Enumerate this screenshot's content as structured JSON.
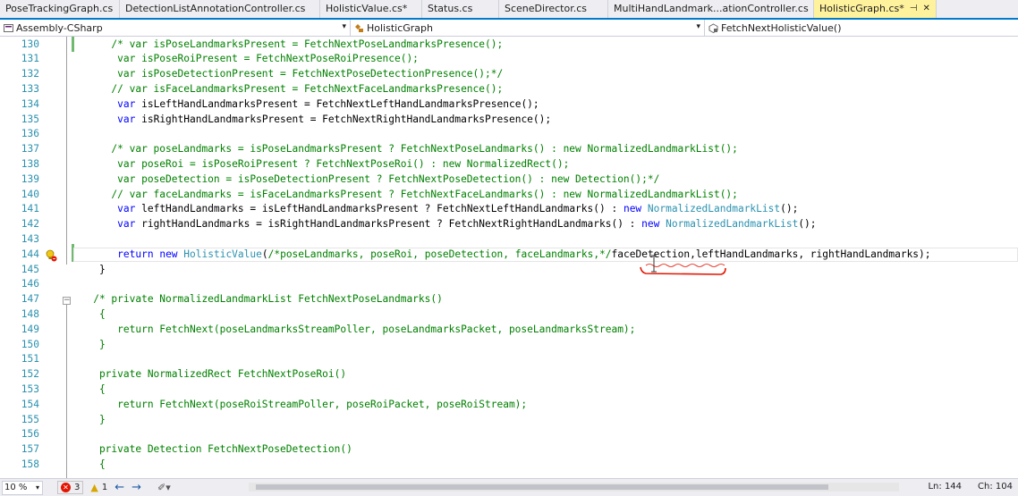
{
  "tabs": [
    {
      "label": "PoseTrackingGraph.cs",
      "width": 134
    },
    {
      "label": "DetectionListAnnotationController.cs",
      "width": 224
    },
    {
      "label": "HolisticValue.cs*",
      "width": 114
    },
    {
      "label": "Status.cs",
      "width": 86
    },
    {
      "label": "SceneDirector.cs",
      "width": 122
    },
    {
      "label": "MultiHandLandmark...ationController.cs",
      "width": 230
    }
  ],
  "active_tab": {
    "label": "HolisticGraph.cs*",
    "pin": "⊣",
    "close": "✕"
  },
  "navbar": {
    "project": "Assembly-CSharp",
    "class": "HolisticGraph",
    "member": "FetchNextHolisticValue()"
  },
  "lines": [
    {
      "n": "130",
      "segs": [
        [
          "cm",
          "      /* var isPoseLandmarksPresent = FetchNextPoseLandmarksPresence();"
        ]
      ]
    },
    {
      "n": "131",
      "segs": [
        [
          "cm",
          "       var isPoseRoiPresent = FetchNextPoseRoiPresence();"
        ]
      ]
    },
    {
      "n": "132",
      "segs": [
        [
          "cm",
          "       var isPoseDetectionPresent = FetchNextPoseDetectionPresence();*/"
        ]
      ]
    },
    {
      "n": "133",
      "segs": [
        [
          "cm",
          "      // var isFaceLandmarksPresent = FetchNextFaceLandmarksPresence();"
        ]
      ]
    },
    {
      "n": "134",
      "segs": [
        [
          "",
          "       "
        ],
        [
          "kw",
          "var"
        ],
        [
          "",
          " isLeftHandLandmarksPresent = FetchNextLeftHandLandmarksPresence();"
        ]
      ]
    },
    {
      "n": "135",
      "segs": [
        [
          "",
          "       "
        ],
        [
          "kw",
          "var"
        ],
        [
          "",
          " isRightHandLandmarksPresent = FetchNextRightHandLandmarksPresence();"
        ]
      ]
    },
    {
      "n": "136",
      "segs": [
        [
          "",
          ""
        ]
      ]
    },
    {
      "n": "137",
      "segs": [
        [
          "cm",
          "      /* var poseLandmarks = isPoseLandmarksPresent ? FetchNextPoseLandmarks() : new NormalizedLandmarkList();"
        ]
      ]
    },
    {
      "n": "138",
      "segs": [
        [
          "cm",
          "       var poseRoi = isPoseRoiPresent ? FetchNextPoseRoi() : new NormalizedRect();"
        ]
      ]
    },
    {
      "n": "139",
      "segs": [
        [
          "cm",
          "       var poseDetection = isPoseDetectionPresent ? FetchNextPoseDetection() : new Detection();*/"
        ]
      ]
    },
    {
      "n": "140",
      "segs": [
        [
          "cm",
          "      // var faceLandmarks = isFaceLandmarksPresent ? FetchNextFaceLandmarks() : new NormalizedLandmarkList();"
        ]
      ]
    },
    {
      "n": "141",
      "segs": [
        [
          "",
          "       "
        ],
        [
          "kw",
          "var"
        ],
        [
          "",
          " leftHandLandmarks = isLeftHandLandmarksPresent ? FetchNextLeftHandLandmarks() : "
        ],
        [
          "kw",
          "new"
        ],
        [
          "",
          " "
        ],
        [
          "ty",
          "NormalizedLandmarkList"
        ],
        [
          "",
          "();"
        ]
      ]
    },
    {
      "n": "142",
      "segs": [
        [
          "",
          "       "
        ],
        [
          "kw",
          "var"
        ],
        [
          "",
          " rightHandLandmarks = isRightHandLandmarksPresent ? FetchNextRightHandLandmarks() : "
        ],
        [
          "kw",
          "new"
        ],
        [
          "",
          " "
        ],
        [
          "ty",
          "NormalizedLandmarkList"
        ],
        [
          "",
          "();"
        ]
      ]
    },
    {
      "n": "143",
      "segs": [
        [
          "",
          ""
        ]
      ]
    },
    {
      "n": "144",
      "segs": [
        [
          "",
          "       "
        ],
        [
          "kw",
          "return"
        ],
        [
          "",
          " "
        ],
        [
          "kw",
          "new"
        ],
        [
          "",
          " "
        ],
        [
          "ty",
          "HolisticValue"
        ],
        [
          "",
          "("
        ],
        [
          "cm",
          "/*poseLandmarks, poseRoi, poseDetection, faceLandmarks,*/"
        ],
        [
          "",
          "faceDetection,leftHandLandmarks, rightHandLandmarks);"
        ]
      ],
      "current": true
    },
    {
      "n": "145",
      "segs": [
        [
          "",
          "    }"
        ]
      ]
    },
    {
      "n": "146",
      "segs": [
        [
          "",
          ""
        ]
      ]
    },
    {
      "n": "147",
      "segs": [
        [
          "cm",
          "   /* private NormalizedLandmarkList FetchNextPoseLandmarks()"
        ]
      ]
    },
    {
      "n": "148",
      "segs": [
        [
          "cm",
          "    {"
        ]
      ]
    },
    {
      "n": "149",
      "segs": [
        [
          "cm",
          "       return FetchNext(poseLandmarksStreamPoller, poseLandmarksPacket, poseLandmarksStream);"
        ]
      ]
    },
    {
      "n": "150",
      "segs": [
        [
          "cm",
          "    }"
        ]
      ]
    },
    {
      "n": "151",
      "segs": [
        [
          "",
          ""
        ]
      ]
    },
    {
      "n": "152",
      "segs": [
        [
          "cm",
          "    private NormalizedRect FetchNextPoseRoi()"
        ]
      ]
    },
    {
      "n": "153",
      "segs": [
        [
          "cm",
          "    {"
        ]
      ]
    },
    {
      "n": "154",
      "segs": [
        [
          "cm",
          "       return FetchNext(poseRoiStreamPoller, poseRoiPacket, poseRoiStream);"
        ]
      ]
    },
    {
      "n": "155",
      "segs": [
        [
          "cm",
          "    }"
        ]
      ]
    },
    {
      "n": "156",
      "segs": [
        [
          "",
          ""
        ]
      ]
    },
    {
      "n": "157",
      "segs": [
        [
          "cm",
          "    private Detection FetchNextPoseDetection()"
        ]
      ]
    },
    {
      "n": "158",
      "segs": [
        [
          "cm",
          "    {"
        ]
      ]
    }
  ],
  "status": {
    "zoom": "10 %",
    "errors": "3",
    "warnings": "1",
    "ln": "Ln: 144",
    "ch": "Ch: 104"
  },
  "colors": {
    "accent": "#007acc",
    "active_tab": "#fff29d",
    "comment": "#008000",
    "keyword": "#0000ff",
    "type": "#2b91af"
  }
}
